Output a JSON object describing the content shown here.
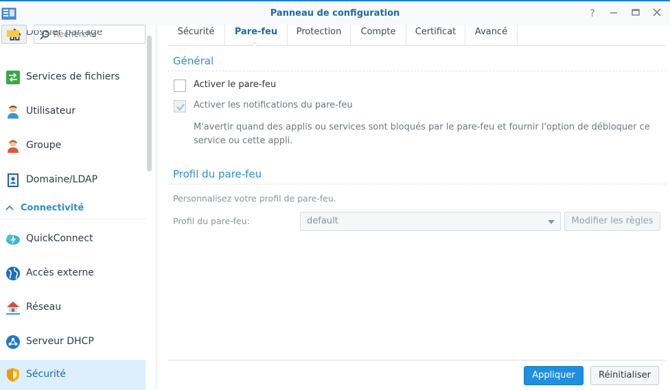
{
  "window": {
    "title": "Panneau de configuration",
    "controls": [
      "help-icon",
      "minimize-icon",
      "maximize-icon",
      "close-icon"
    ]
  },
  "sidebar": {
    "search_placeholder": "Recherche",
    "partial_item": "Dossier partagé",
    "items": [
      {
        "label": "Services de fichiers",
        "icon": "file-services-icon"
      },
      {
        "label": "Utilisateur",
        "icon": "user-icon"
      },
      {
        "label": "Groupe",
        "icon": "group-icon"
      },
      {
        "label": "Domaine/LDAP",
        "icon": "domain-ldap-icon"
      }
    ],
    "section": "Connectivité",
    "section_items": [
      {
        "label": "QuickConnect",
        "icon": "quickconnect-icon"
      },
      {
        "label": "Accès externe",
        "icon": "external-access-icon"
      },
      {
        "label": "Réseau",
        "icon": "network-icon"
      },
      {
        "label": "Serveur DHCP",
        "icon": "dhcp-server-icon"
      },
      {
        "label": "Sécurité",
        "icon": "security-shield-icon",
        "active": true
      }
    ]
  },
  "tabs": [
    {
      "label": "Sécurité"
    },
    {
      "label": "Pare-feu",
      "active": true
    },
    {
      "label": "Protection"
    },
    {
      "label": "Compte"
    },
    {
      "label": "Certificat"
    },
    {
      "label": "Avancé"
    }
  ],
  "general": {
    "title": "Général",
    "enable_firewall": {
      "label": "Activer le pare-feu",
      "checked": false
    },
    "enable_notifications": {
      "label": "Activer les notifications du pare-feu",
      "checked": true,
      "disabled": true
    },
    "description": "M'avertir quand des applis ou services sont bloqués par le pare-feu et fournir l'option de débloquer ce service ou cette appli."
  },
  "profile": {
    "title": "Profil du pare-feu",
    "hint": "Personnalisez votre profil de pare-feu.",
    "field_label": "Profil du pare-feu:",
    "selected": "default",
    "edit_rules": "Modifier les règles"
  },
  "footer": {
    "apply": "Appliquer",
    "reset": "Réinitialiser"
  },
  "colors": {
    "accent": "#1f8fe0",
    "section_title": "#2b8dd6",
    "active_bg": "#ddeefd"
  }
}
